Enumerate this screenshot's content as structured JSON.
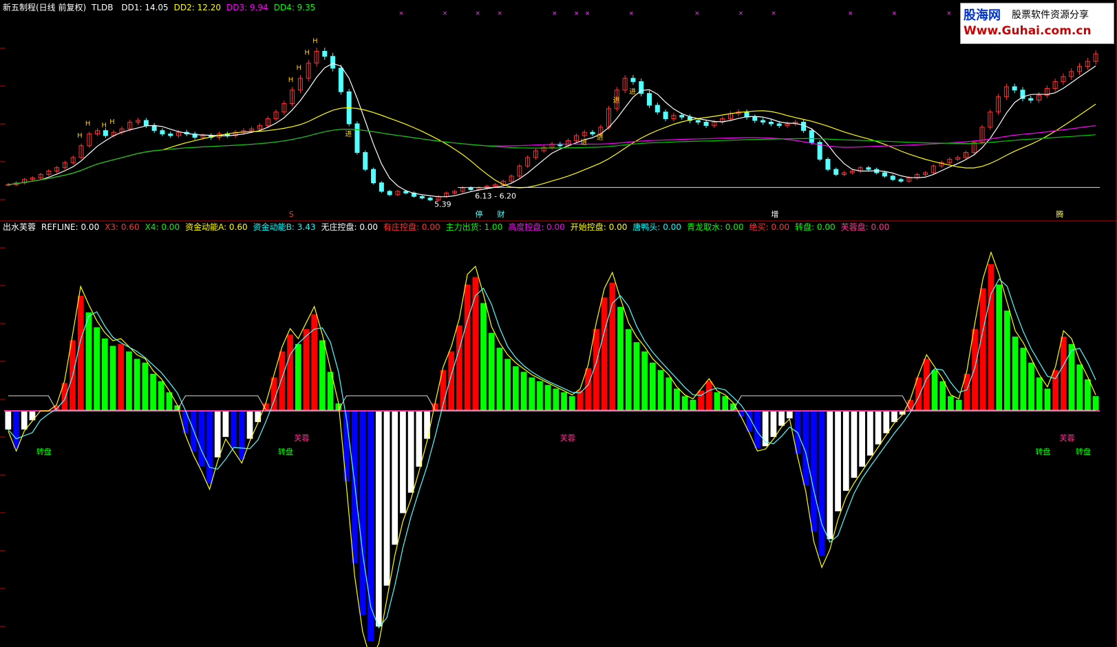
{
  "main_header": {
    "title": "新五制程(日线 前复权)",
    "code": "TLDB",
    "items": [
      {
        "label": "DD1: 14.05",
        "color": "#ffffff"
      },
      {
        "label": "DD2: 12.20",
        "color": "#ffff00"
      },
      {
        "label": "DD3: 9.94",
        "color": "#ff00ff"
      },
      {
        "label": "DD4: 9.35",
        "color": "#00ff00"
      }
    ]
  },
  "sub_header": {
    "items": [
      {
        "label": "出水芙蓉",
        "color": "#ffffff"
      },
      {
        "label": "REFLINE: 0.00",
        "color": "#ffffff"
      },
      {
        "label": "X3: 0.60",
        "color": "#ff3333"
      },
      {
        "label": "X4: 0.00",
        "color": "#00ff00"
      },
      {
        "label": "资金动能A: 0.60",
        "color": "#ffff00"
      },
      {
        "label": "资金动能B: 3.43",
        "color": "#00ffff"
      },
      {
        "label": "无庄控盘: 0.00",
        "color": "#ffffff"
      },
      {
        "label": "有庄控盘: 0.00",
        "color": "#ff3333"
      },
      {
        "label": "主力出货: 1.00",
        "color": "#00ff00"
      },
      {
        "label": "高度控盘: 0.00",
        "color": "#ff00ff"
      },
      {
        "label": "开始控盘: 0.00",
        "color": "#ffff00"
      },
      {
        "label": "唐鸭头: 0.00",
        "color": "#00ffff"
      },
      {
        "label": "青龙取水: 0.00",
        "color": "#00ff00"
      },
      {
        "label": "绝买: 0.00",
        "color": "#ff3333"
      },
      {
        "label": "转盘: 0.00",
        "color": "#00ff00"
      },
      {
        "label": "芙蓉盘: 0.00",
        "color": "#ff3399"
      }
    ]
  },
  "logo": {
    "line1": "股海网",
    "line2": "股票软件资源分享",
    "line3": "Www.Guhai.com.cn"
  },
  "chart_data": [
    {
      "type": "candlestick",
      "annotations": {
        "low_label": "5.39",
        "range_label": "6.13 - 6.20",
        "event_markers": [
          "S",
          "停",
          "财",
          "增",
          "腾"
        ],
        "signal_text": [
          "H",
          "进",
          "转盘",
          "芙蓉"
        ]
      },
      "closes": [
        6.3,
        6.4,
        6.6,
        6.7,
        6.9,
        7.1,
        7.3,
        7.6,
        7.9,
        8.6,
        9.3,
        9.5,
        9.2,
        9.4,
        9.6,
        10,
        10.1,
        9.8,
        9.5,
        9.3,
        9.2,
        9.4,
        9.3,
        9.1,
        9.2,
        9.1,
        9.3,
        9.2,
        9.4,
        9.5,
        9.6,
        9.8,
        10.2,
        10.6,
        11.1,
        11.9,
        12.6,
        13.5,
        14.2,
        13.9,
        13.2,
        11.8,
        9.9,
        8.2,
        7.2,
        6.4,
        5.9,
        5.7,
        5.9,
        5.8,
        5.6,
        5.5,
        5.39,
        5.6,
        5.8,
        5.9,
        6.1,
        6.0,
        6.1,
        6.2,
        6.3,
        6.5,
        6.8,
        7.4,
        7.9,
        8.3,
        8.5,
        8.7,
        8.6,
        8.9,
        9.2,
        9.4,
        9.3,
        9.7,
        10.8,
        11.9,
        12.6,
        12.4,
        11.7,
        11.0,
        10.6,
        10.2,
        10.4,
        10.3,
        10.1,
        10.0,
        9.8,
        10.0,
        10.2,
        10.5,
        10.6,
        10.3,
        10.1,
        10.0,
        9.9,
        9.8,
        9.9,
        10.0,
        9.5,
        8.8,
        7.8,
        7.2,
        6.9,
        7.0,
        7.1,
        7.3,
        7.2,
        7.0,
        6.8,
        6.6,
        6.5,
        6.7,
        6.9,
        7.0,
        7.4,
        7.6,
        7.8,
        7.9,
        8.2,
        8.8,
        9.7,
        10.6,
        11.5,
        12.1,
        11.9,
        11.4,
        11.3,
        11.6,
        12.0,
        12.4,
        12.7,
        13.0,
        13.3,
        13.6,
        14.05
      ]
    },
    {
      "type": "bar",
      "values": [
        -1,
        -2,
        -1,
        -0.5,
        0,
        0,
        0.3,
        1.5,
        3.8,
        6.2,
        5.3,
        4.5,
        3.9,
        3.5,
        3.6,
        3.2,
        2.8,
        2.6,
        2.0,
        1.6,
        1.0,
        0.3,
        -1.2,
        -2.2,
        -3.0,
        -3.9,
        -2.5,
        -1.4,
        -2.0,
        -2.6,
        -1.5,
        -0.6,
        0.4,
        1.8,
        3.2,
        4.1,
        3.6,
        4.4,
        5.2,
        3.8,
        2.1,
        0.4,
        -3.8,
        -8.2,
        -11.0,
        -12.4,
        -11.6,
        -9.4,
        -7.2,
        -5.5,
        -4.4,
        -3.0,
        -1.5,
        0.4,
        2.2,
        3.2,
        4.6,
        6.8,
        7.2,
        5.8,
        4.2,
        3.4,
        2.8,
        2.4,
        2.1,
        1.8,
        1.6,
        1.4,
        1.2,
        1.0,
        0.8,
        1.1,
        2.3,
        4.4,
        6.1,
        6.9,
        5.6,
        4.4,
        3.7,
        3.2,
        2.6,
        2.2,
        1.8,
        1.2,
        0.8,
        0.6,
        1.1,
        1.6,
        1.0,
        0.8,
        0.4,
        -0.3,
        -1.1,
        -2.0,
        -1.9,
        -1.4,
        -0.8,
        -0.4,
        -2.3,
        -4.0,
        -6.5,
        -7.8,
        -6.9,
        -5.4,
        -4.3,
        -3.6,
        -3.0,
        -2.4,
        -1.8,
        -1.2,
        -0.6,
        -0.2,
        0.6,
        1.8,
        2.8,
        2.2,
        1.6,
        0.8,
        0.6,
        2.0,
        4.4,
        6.6,
        7.9,
        6.8,
        5.4,
        4.0,
        3.4,
        2.6,
        1.8,
        1.2,
        2.2,
        4.0,
        3.6,
        2.5,
        1.7,
        0.8
      ]
    }
  ],
  "colors": {
    "up": "#ff3333",
    "down": "#54ffff",
    "ma1": "#ffffff",
    "ma2": "#ffff00",
    "ma3": "#ff00ff",
    "ma4": "#00cc00",
    "red_bar": "#ff0000",
    "green_bar": "#00ff00",
    "blue_bar": "#0000ff",
    "axis": "#cc0000"
  }
}
